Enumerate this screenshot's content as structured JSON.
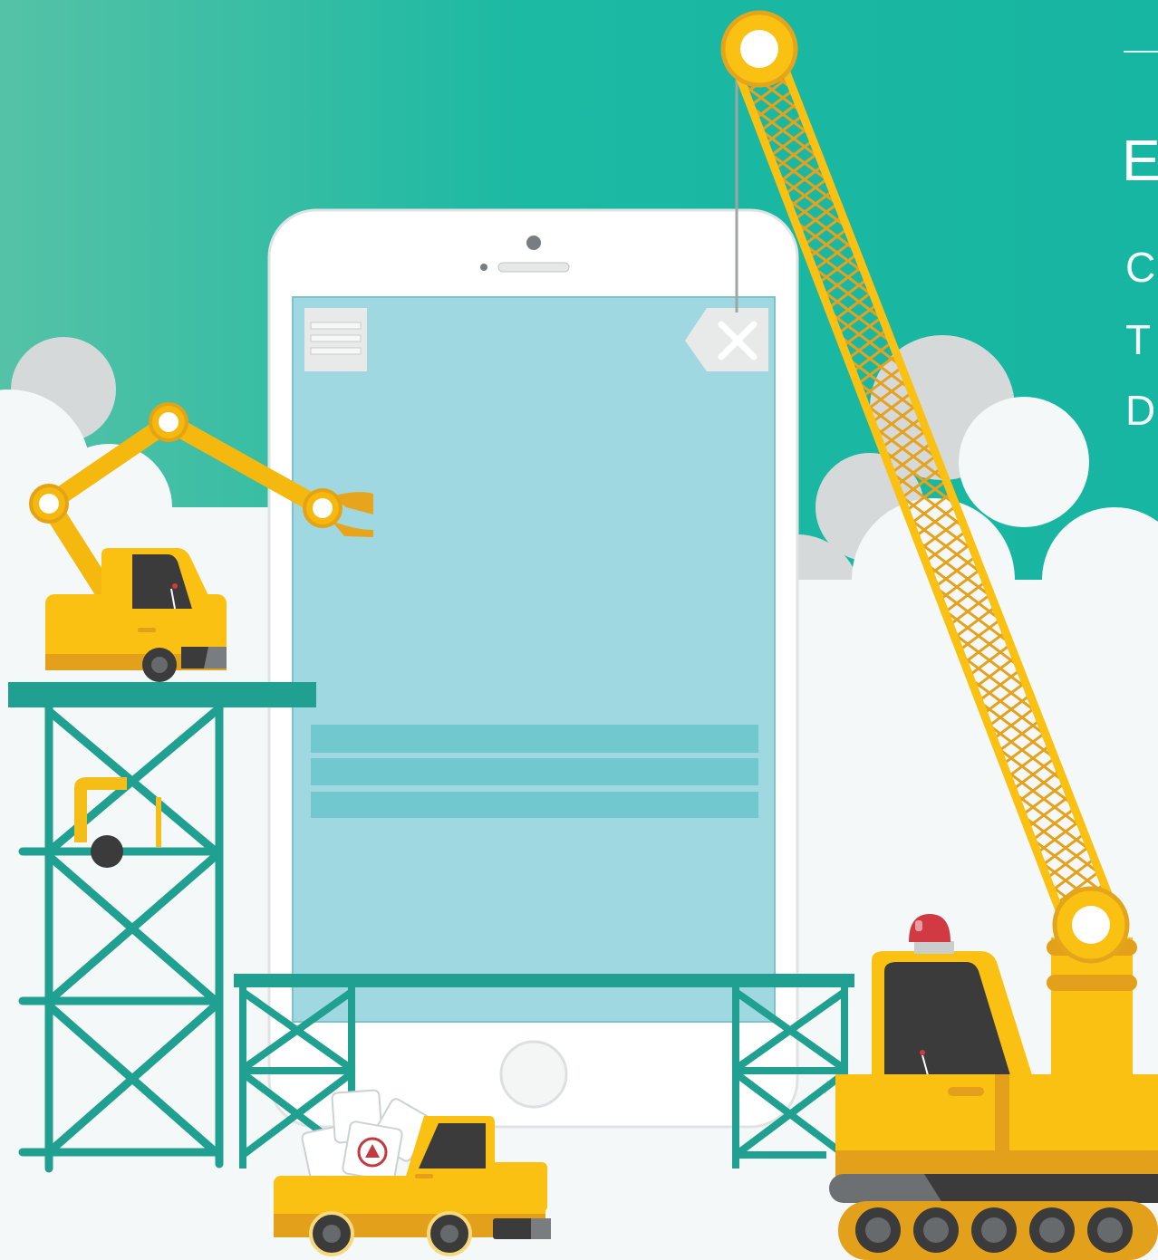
{
  "hero": {
    "title": "E",
    "lines": [
      "C",
      "T",
      "D"
    ]
  },
  "phone": {
    "menu_icon": "hamburger-icon",
    "close_icon": "close-icon"
  },
  "colors": {
    "sky": "#1cb9a3",
    "cloud": "#f5f8f8",
    "cloud_shadow": "#d5d9d9",
    "scaffold": "#1fa091",
    "machine_yellow": "#fbc112",
    "machine_dark": "#3b3b3b",
    "screen": "#9fd8e1"
  }
}
